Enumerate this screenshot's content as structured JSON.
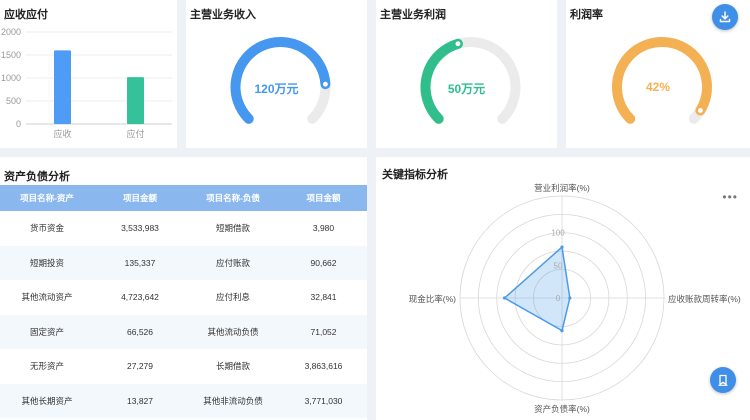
{
  "ar_card": {
    "title": "应收应付",
    "chart_data": {
      "type": "bar",
      "categories": [
        "应收",
        "应付"
      ],
      "values": [
        1600,
        1020
      ],
      "yticks": [
        "2000",
        "1500",
        "1000",
        "500",
        "0"
      ],
      "ylim": [
        0,
        2000
      ],
      "grid": true,
      "colors": [
        "#4e9cf6",
        "#35c29a"
      ]
    }
  },
  "revenue_card": {
    "title": "主营业务收入",
    "value_label": "120万元",
    "color": "#4597ef",
    "progress_fraction": 0.82
  },
  "profit_card": {
    "title": "主营业务利润",
    "value_label": "50万元",
    "color": "#2fbe8c",
    "progress_fraction": 0.44
  },
  "rate_card": {
    "title": "利润率",
    "value_label": "42%",
    "color": "#f4b154",
    "progress_fraction": 0.95
  },
  "balance_sheet": {
    "title": "资产负债分析",
    "columns": [
      "项目名称-资产",
      "项目金额",
      "项目名称-负债",
      "项目金额"
    ],
    "rows": [
      [
        "货币资金",
        "3,533,983",
        "短期借款",
        "3,980"
      ],
      [
        "短期投资",
        "135,337",
        "应付账款",
        "90,662"
      ],
      [
        "其他流动资产",
        "4,723,642",
        "应付利息",
        "32,841"
      ],
      [
        "固定资产",
        "66,526",
        "其他流动负债",
        "71,052"
      ],
      [
        "无形资产",
        "27,279",
        "长期借款",
        "3,863,616"
      ],
      [
        "其他长期资产",
        "13,827",
        "其他非流动负债",
        "3,771,030"
      ]
    ]
  },
  "kpi_card": {
    "title": "关键指标分析",
    "more_icon": "more-horizontal-icon",
    "chart_data": {
      "type": "radar",
      "indicators": [
        "营业利润率(%)",
        "应收账款周转率(%)",
        "资产负债率(%)",
        "现金比率(%)"
      ],
      "values": [
        78,
        12,
        50,
        88
      ],
      "ticks": [
        "100",
        "50",
        "0"
      ],
      "range": [
        0,
        100
      ],
      "color": "#4b9be8"
    }
  },
  "toolbar": {
    "download_icon": "download-icon",
    "bookmark_icon": "bookmark-icon"
  }
}
